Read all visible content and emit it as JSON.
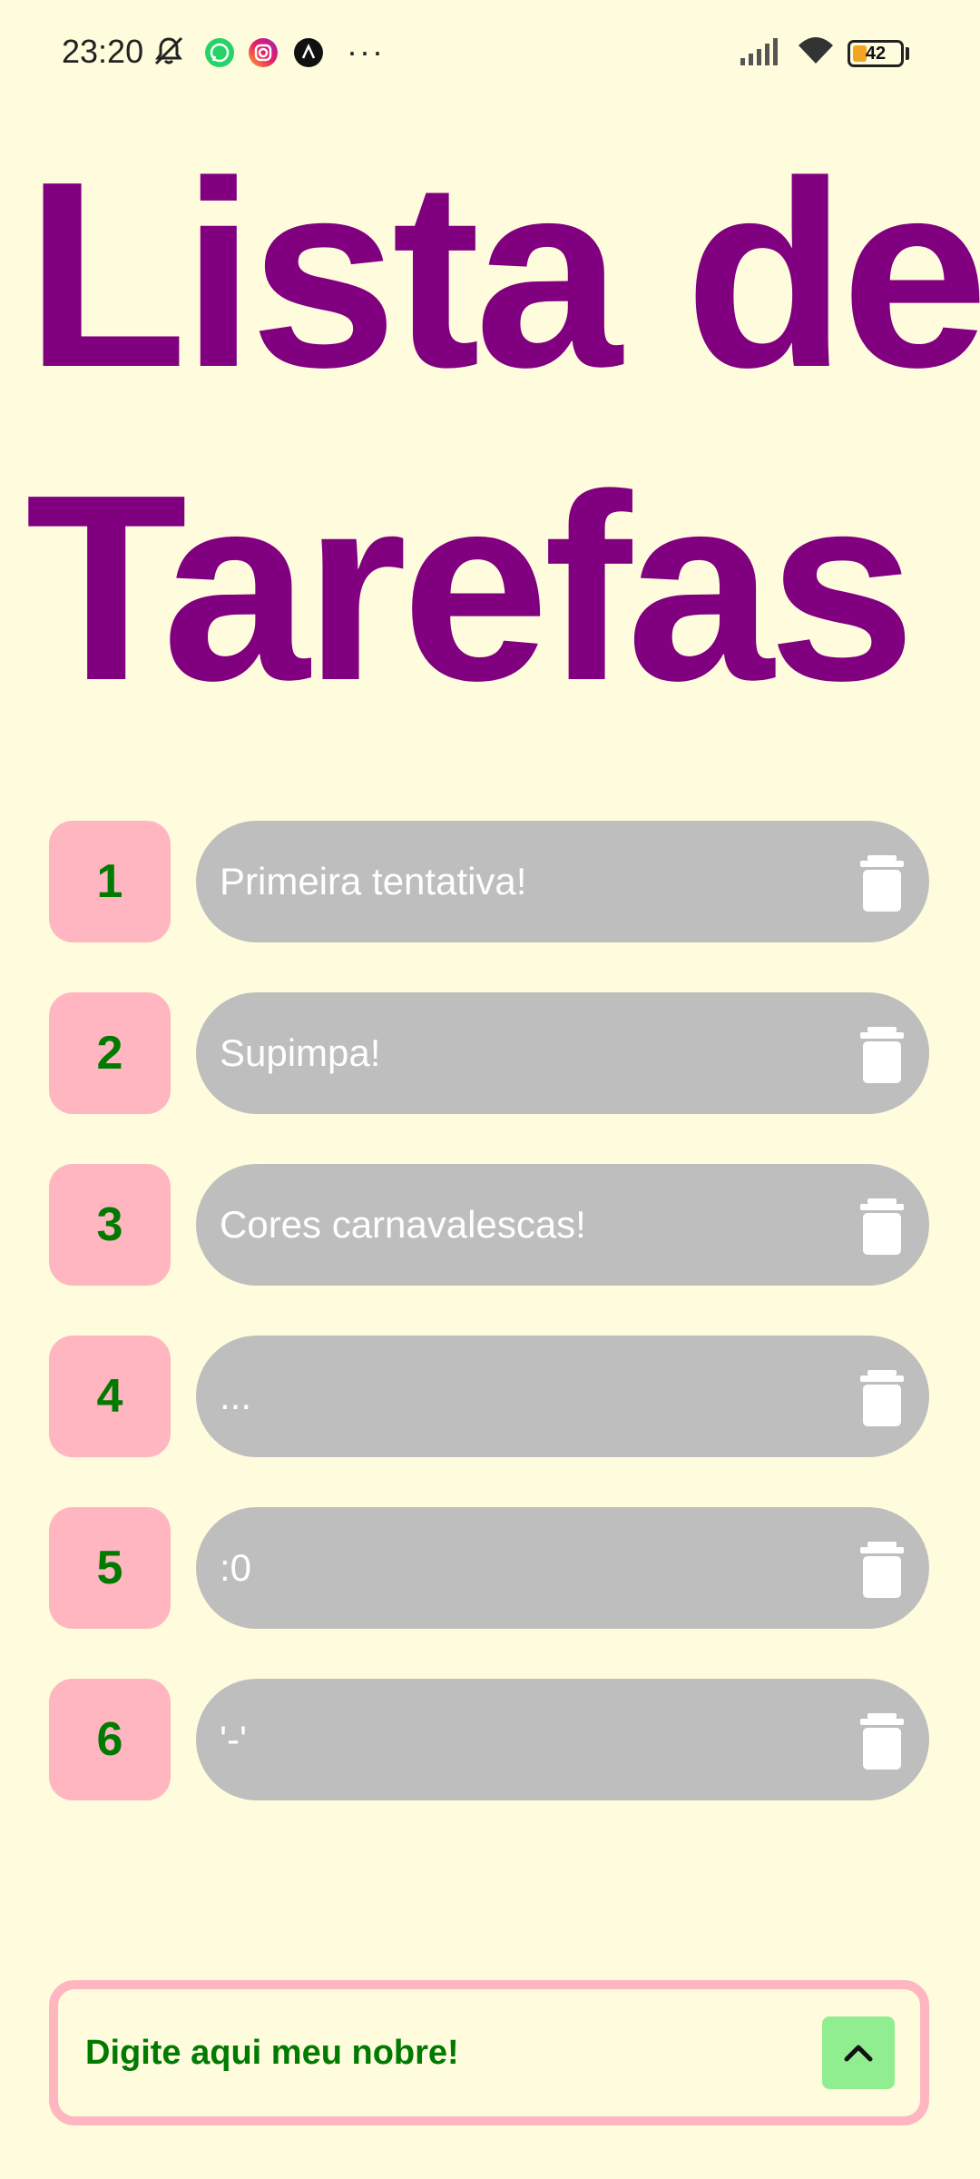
{
  "status_bar": {
    "time": "23:20",
    "battery_level": "42",
    "notification_icons": [
      "bell-off-icon",
      "whatsapp-icon",
      "instagram-icon",
      "app-icon"
    ],
    "overflow": "···"
  },
  "title": "Lista de Tarefas",
  "title_lines": [
    "Lista de",
    "Tarefas"
  ],
  "colors": {
    "background": "#FEFCDC",
    "title": "#800080",
    "number_bg": "#FFB6C1",
    "number_text": "#007A00",
    "task_bg": "#BEBEBE",
    "task_text": "#FFFFFF",
    "input_border": "#FFB6C1",
    "add_button_bg": "#90EE90"
  },
  "tasks": [
    {
      "number": "1",
      "text": "Primeira tentativa!"
    },
    {
      "number": "2",
      "text": "Supimpa!"
    },
    {
      "number": "3",
      "text": "Cores carnavalescas!"
    },
    {
      "number": "4",
      "text": "..."
    },
    {
      "number": "5",
      "text": ":0"
    },
    {
      "number": "6",
      "text": "'-'"
    }
  ],
  "input": {
    "placeholder": "Digite aqui meu nobre!",
    "value": ""
  },
  "add_button_icon": "chevron-up-icon"
}
